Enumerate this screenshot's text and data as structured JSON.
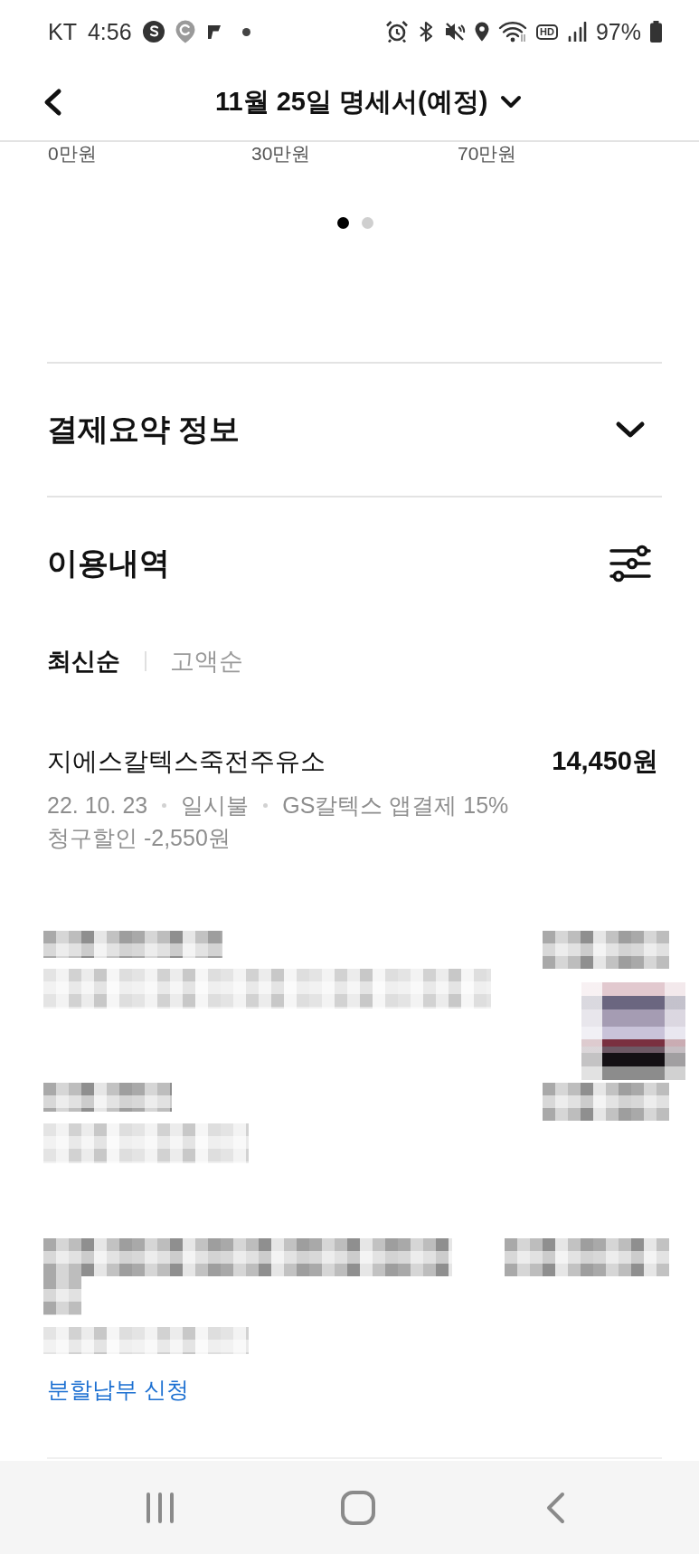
{
  "status_bar": {
    "carrier": "KT",
    "time": "4:56",
    "hd_label": "HD",
    "battery": "97%"
  },
  "header": {
    "title": "11월 25일 명세서(예정)"
  },
  "chart_axis_labels": [
    "0만원",
    "30만원",
    "70만원"
  ],
  "pager": [
    {
      "selected": true
    },
    {
      "selected": false
    }
  ],
  "summary_section": {
    "title": "결제요약 정보",
    "expanded": false
  },
  "history": {
    "title": "이용내역",
    "sort_tabs": [
      {
        "label": "최신순",
        "selected": true
      },
      {
        "label": "고액순",
        "selected": false
      }
    ],
    "transactions": [
      {
        "kind": "entry",
        "merchant": "지에스칼텍스죽전주유소",
        "amount": "14,450원",
        "details": [
          "22. 10. 23",
          "일시불",
          "GS칼텍스 앱결제 15%"
        ],
        "discount": "청구할인 -2,550원"
      },
      {
        "kind": "redacted",
        "thumbnail": true
      },
      {
        "kind": "redacted",
        "thumbnail": false
      },
      {
        "kind": "redacted",
        "thumbnail": false,
        "link": "분할납부 신청"
      }
    ]
  }
}
